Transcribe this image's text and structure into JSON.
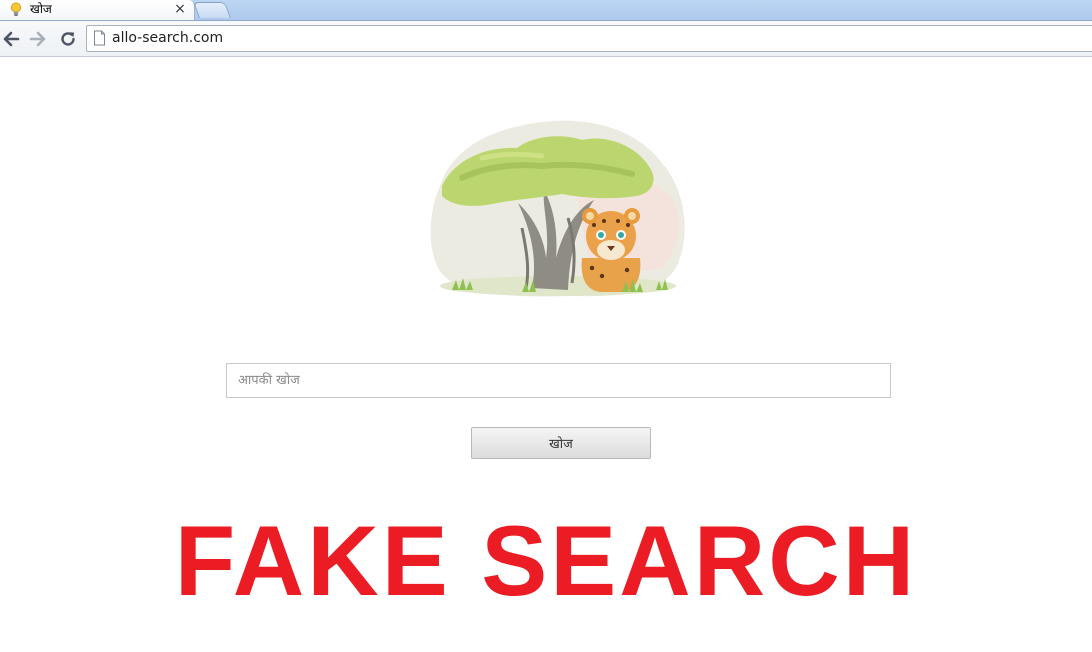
{
  "browser": {
    "tab": {
      "title": "खोज",
      "favicon": "lightbulb-icon",
      "close_label": "×"
    },
    "new_tab_icon": "new-tab-icon",
    "toolbar": {
      "back_icon": "back-arrow-icon",
      "forward_icon": "forward-arrow-icon",
      "reload_icon": "reload-icon"
    },
    "address_bar": {
      "page_icon": "page-icon",
      "url": "allo-search.com"
    }
  },
  "page": {
    "logo": {
      "description": "tree-with-leopard-illustration"
    },
    "search": {
      "placeholder": "आपकी खोज",
      "value": "",
      "button_label": "खोज"
    },
    "overlay_caption": "FAKE SEARCH"
  },
  "colors": {
    "overlay": "#ec1c24",
    "tab_strip": "#b8d2f2",
    "foliage": "#b9d56f",
    "leopard": "#e89a3c"
  }
}
